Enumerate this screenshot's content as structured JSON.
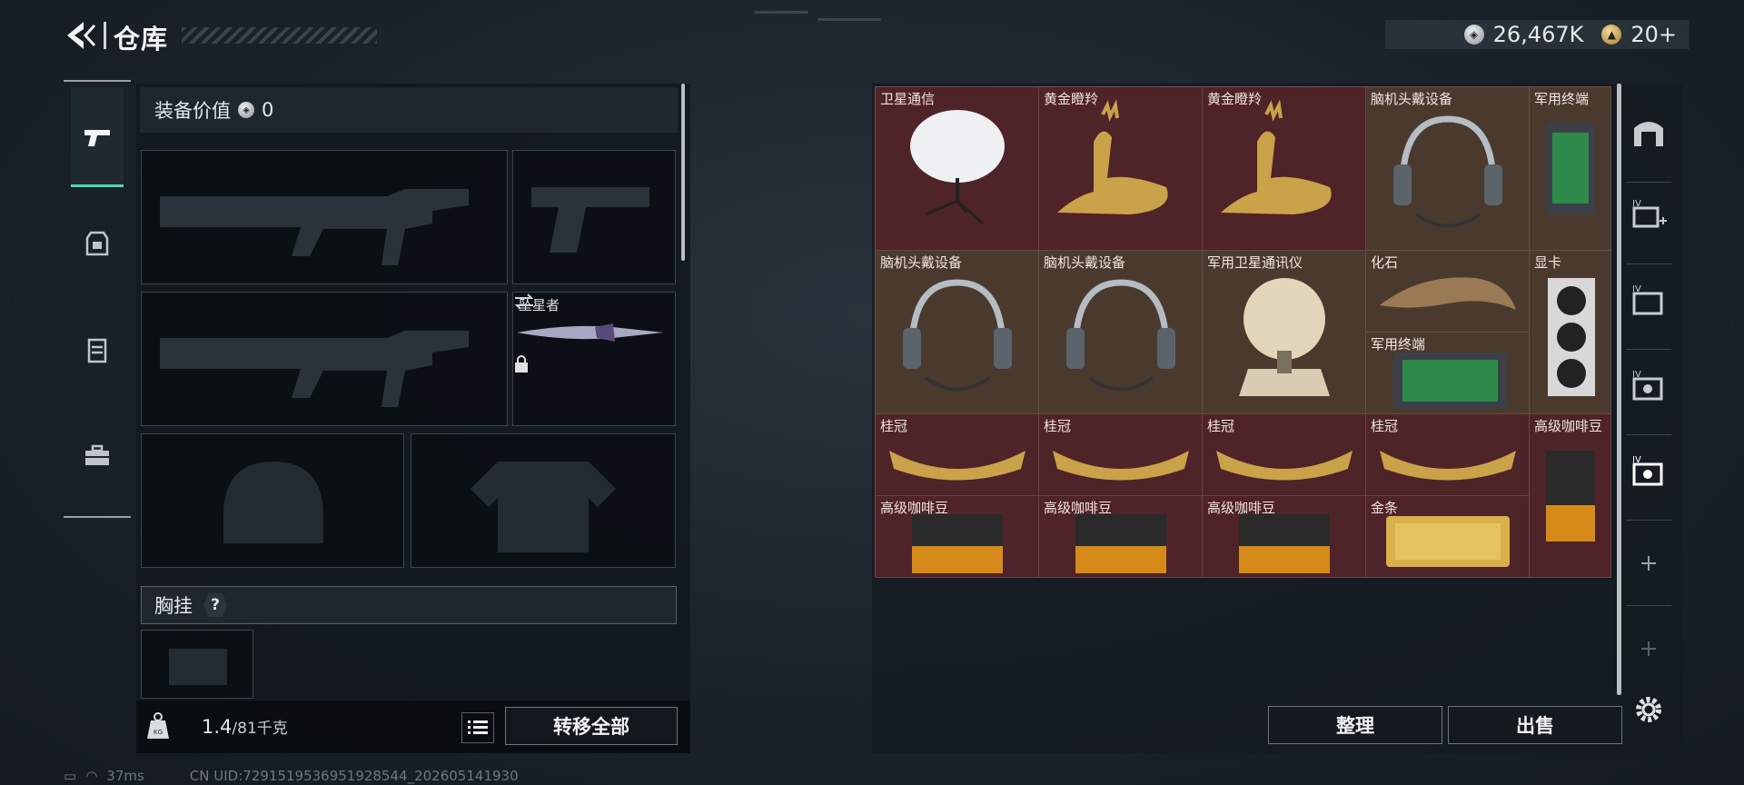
{
  "header": {
    "title": "仓库",
    "currency_silver": "26,467K",
    "currency_gold": "20+"
  },
  "left_nav": {
    "items": [
      "pistol-icon",
      "backpack-icon",
      "vest-icon",
      "toolbox-icon"
    ],
    "active_index": 0
  },
  "equipment": {
    "value_label": "装备价值",
    "value": "0",
    "melee_slot_label": "坠星者",
    "chest_rig_label": "胸挂",
    "chest_rig_help": "?",
    "weight_current": "1.4",
    "weight_max": "/81千克",
    "transfer_all": "转移全部"
  },
  "storage": {
    "rows": [
      [
        "卫星通信",
        "黄金瞪羚",
        "黄金瞪羚",
        "脑机头戴设备",
        "军用终端"
      ],
      [
        "脑机头戴设备",
        "脑机头戴设备",
        "军用卫星通讯仪",
        "化石",
        "显卡"
      ],
      [
        "军用终端"
      ],
      [
        "桂冠",
        "桂冠",
        "桂冠",
        "桂冠",
        "高级咖啡豆"
      ],
      [
        "高级咖啡豆",
        "高级咖啡豆",
        "高级咖啡豆",
        "金条"
      ]
    ],
    "sort_button": "整理",
    "sell_button": "出售"
  },
  "right_rail": {
    "items": [
      "armory-icon",
      "add-tab-icon",
      "folder-tab-icon",
      "gear-tab-icon",
      "active-tab-icon",
      "plus-icon",
      "plus-icon",
      "settings-icon"
    ]
  },
  "status": {
    "ping": "37ms",
    "uid": "CN UID:7291519536951928544_202605141930"
  },
  "colors": {
    "accent": "#4ed8b0",
    "storage_bg": "#5c2a2e"
  }
}
